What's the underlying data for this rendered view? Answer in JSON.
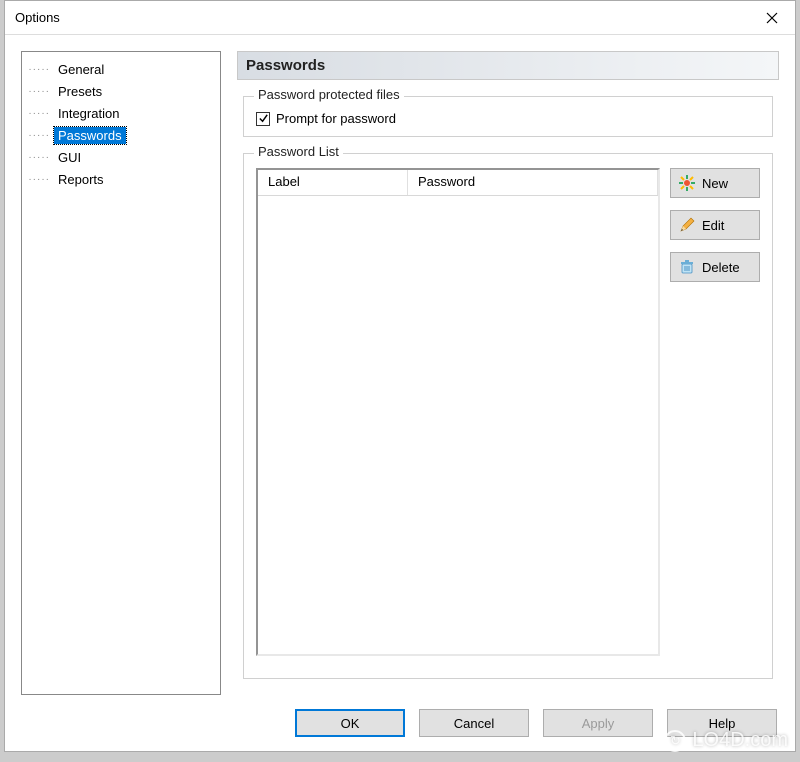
{
  "window": {
    "title": "Options"
  },
  "tree": {
    "items": [
      {
        "label": "General",
        "selected": false
      },
      {
        "label": "Presets",
        "selected": false
      },
      {
        "label": "Integration",
        "selected": false
      },
      {
        "label": "Passwords",
        "selected": true
      },
      {
        "label": "GUI",
        "selected": false
      },
      {
        "label": "Reports",
        "selected": false
      }
    ]
  },
  "page": {
    "heading": "Passwords",
    "group_protected": {
      "legend": "Password protected files",
      "prompt_checked": true,
      "prompt_label": "Prompt for password"
    },
    "group_list": {
      "legend": "Password List",
      "columns": {
        "label": "Label",
        "password": "Password"
      },
      "buttons": {
        "new": "New",
        "edit": "Edit",
        "delete": "Delete"
      }
    }
  },
  "footer": {
    "ok": "OK",
    "cancel": "Cancel",
    "apply": "Apply",
    "help": "Help"
  },
  "watermark": "LO4D.com"
}
